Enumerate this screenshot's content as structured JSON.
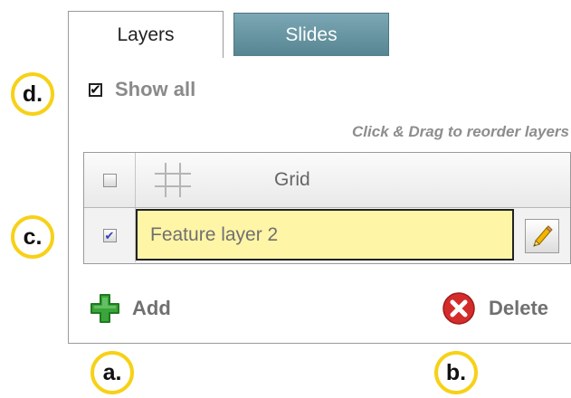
{
  "tabs": [
    {
      "label": "Layers",
      "active": true
    },
    {
      "label": "Slides",
      "active": false
    }
  ],
  "show_all": {
    "label": "Show all",
    "checked": true
  },
  "hint": "Click & Drag to reorder layers",
  "layers": [
    {
      "name": "Grid",
      "checked": false,
      "icon": "grid-icon"
    },
    {
      "name": "Feature layer 2",
      "checked": true,
      "editing": true,
      "edit_icon": "pencil-icon"
    }
  ],
  "actions": {
    "add_label": "Add",
    "add_icon": "plus-icon",
    "delete_label": "Delete",
    "delete_icon": "delete-x-icon"
  },
  "markers": {
    "a": "a.",
    "b": "b.",
    "c": "c.",
    "d": "d."
  },
  "colors": {
    "marker_ring": "#f7d117",
    "slides_tab": "#6a98a6",
    "editing_bg": "#fff5a6",
    "add_green": "#3aa53a",
    "delete_red": "#d42b2b"
  }
}
